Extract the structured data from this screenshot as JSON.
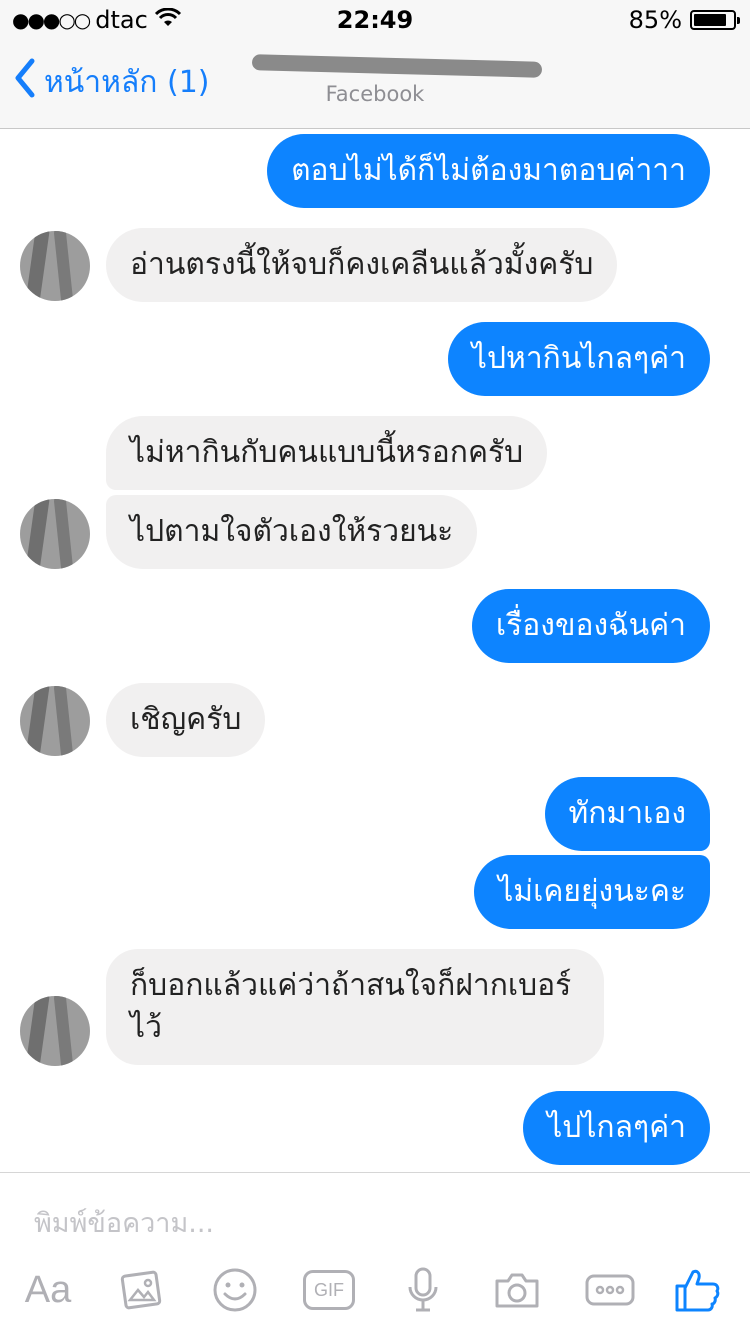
{
  "status_bar": {
    "carrier": "dtac",
    "signal_dots": "●●●○○",
    "time": "22:49",
    "battery_text": "85%",
    "battery_level": 0.85
  },
  "nav": {
    "back_label": "หน้าหลัก (1)",
    "subtitle": "Facebook",
    "accent_color": "#157efb"
  },
  "messages": [
    {
      "side": "out",
      "text": "ตอบไม่ได้ก็ไม่ต้องมาตอบค่าาา"
    },
    {
      "side": "in",
      "text": "อ่านตรงนี้ให้จบก็คงเคลีนแล้วมั้งครับ"
    },
    {
      "side": "out",
      "text": "ไปหากินไกลๆค่า"
    },
    {
      "side": "in",
      "text": "ไม่หากินกับคนแบบนี้หรอกครับ"
    },
    {
      "side": "in",
      "text": "ไปตามใจตัวเองให้รวยนะ"
    },
    {
      "side": "out",
      "text": "เรื่องของฉันค่า"
    },
    {
      "side": "in",
      "text": "เชิญครับ"
    },
    {
      "side": "out",
      "text": "ทักมาเอง"
    },
    {
      "side": "out",
      "text": "ไม่เคยยุ่งนะคะ"
    },
    {
      "side": "in",
      "text": "ก็บอกแล้วแค่ว่าถ้าสนใจก็ฝากเบอร์ไว้"
    },
    {
      "side": "out",
      "text": "ไปไกลๆค่า"
    }
  ],
  "composer": {
    "placeholder": "พิมพ์ข้อความ...",
    "tools": [
      "text-format-icon",
      "photo-icon",
      "emoji-icon",
      "gif-icon",
      "microphone-icon",
      "camera-icon",
      "more-icon",
      "thumbs-up-icon"
    ],
    "aa_label": "Aa",
    "gif_label": "GIF"
  },
  "colors": {
    "outgoing_bubble": "#0d84ff",
    "incoming_bubble": "#f1f0f0",
    "like_icon": "#0d84ff"
  }
}
